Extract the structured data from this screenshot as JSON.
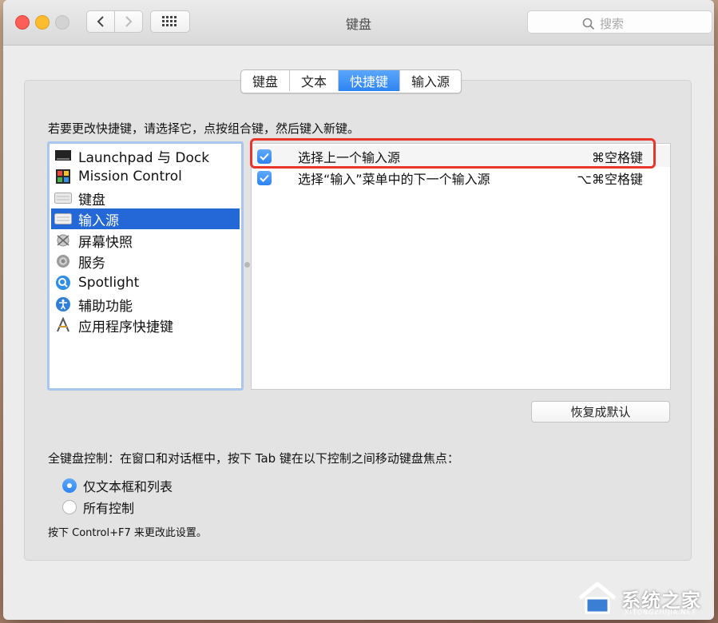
{
  "window": {
    "title": "键盘",
    "search_placeholder": "搜索"
  },
  "tabs": [
    {
      "label": "键盘",
      "active": false
    },
    {
      "label": "文本",
      "active": false
    },
    {
      "label": "快捷键",
      "active": true
    },
    {
      "label": "输入源",
      "active": false
    }
  ],
  "instruction": "若要更改快捷键，请选择它，点按组合键，然后键入新键。",
  "categories": [
    {
      "label": "Launchpad 与 Dock",
      "icon": "launchpad-dock-icon",
      "selected": false
    },
    {
      "label": "Mission Control",
      "icon": "mission-control-icon",
      "selected": false
    },
    {
      "label": "键盘",
      "icon": "keyboard-icon",
      "selected": false
    },
    {
      "label": "输入源",
      "icon": "input-source-icon",
      "selected": true
    },
    {
      "label": "屏幕快照",
      "icon": "screenshot-icon",
      "selected": false
    },
    {
      "label": "服务",
      "icon": "gear-icon",
      "selected": false
    },
    {
      "label": "Spotlight",
      "icon": "spotlight-icon",
      "selected": false
    },
    {
      "label": "辅助功能",
      "icon": "accessibility-icon",
      "selected": false
    },
    {
      "label": "应用程序快捷键",
      "icon": "app-shortcuts-icon",
      "selected": false
    }
  ],
  "shortcuts": [
    {
      "checked": true,
      "label": "选择上一个输入源",
      "keys": "⌘空格键"
    },
    {
      "checked": true,
      "label": "选择“输入”菜单中的下一个输入源",
      "keys": "⌥⌘空格键"
    }
  ],
  "restore_button": "恢复成默认",
  "keyboard_control": {
    "label": "全键盘控制：在窗口和对话框中，按下 Tab 键在以下控制之间移动键盘焦点：",
    "options": [
      {
        "label": "仅文本框和列表",
        "selected": true
      },
      {
        "label": "所有控制",
        "selected": false
      }
    ],
    "hint": "按下 Control+F7 来更改此设置。"
  },
  "watermark": {
    "text": "系统之家",
    "url": "XITONGZHIJIA.NET"
  },
  "colors": {
    "accent": "#2e84f3",
    "selection": "#2468d8",
    "highlight_box": "#e8362b"
  }
}
